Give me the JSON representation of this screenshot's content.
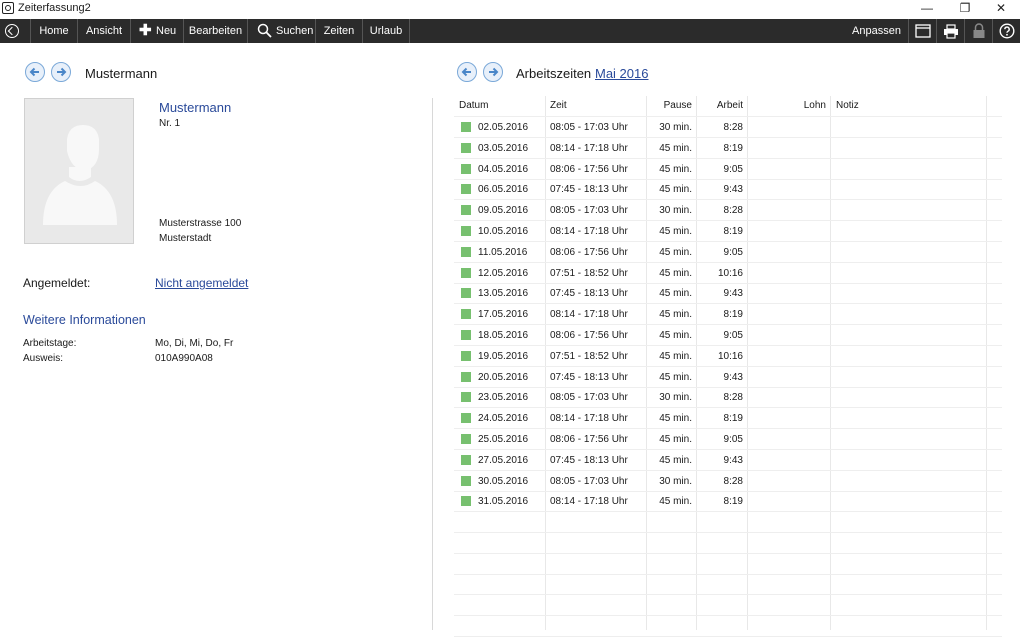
{
  "window": {
    "title": "Zeiterfassung2",
    "controls": [
      "—",
      "❐",
      "✕"
    ]
  },
  "toolbar": {
    "home": "Home",
    "ansicht": "Ansicht",
    "neu": "Neu",
    "bearbeiten": "Bearbeiten",
    "suchen": "Suchen",
    "zeiten": "Zeiten",
    "urlaub": "Urlaub",
    "anpassen": "Anpassen",
    "icons": [
      "back-icon",
      "plus-icon",
      "search-icon",
      "window-icon",
      "print-icon",
      "lock-icon",
      "help-icon"
    ]
  },
  "employee": {
    "header_name": "Mustermann",
    "display_name": "Mustermann",
    "number": "Nr. 1",
    "street": "Musterstrasse 100",
    "city": "Musterstadt",
    "login_label": "Angemeldet:",
    "login_status": "Nicht angemeldet"
  },
  "details": {
    "title": "Weitere Informationen",
    "workdays_label": "Arbeitstage:",
    "workdays_value": "Mo, Di, Mi, Do, Fr",
    "badge_label": "Ausweis:",
    "badge_value": "010A990A08"
  },
  "times": {
    "title": "Arbeitszeiten",
    "month": "Mai 2016",
    "columns": {
      "datum": "Datum",
      "zeit": "Zeit",
      "pause": "Pause",
      "arbeit": "Arbeit",
      "lohn": "Lohn",
      "notiz": "Notiz"
    },
    "status_color": "#77c06f",
    "rows": [
      {
        "datum": "02.05.2016",
        "zeit": "08:05 - 17:03 Uhr",
        "pause": "30 min.",
        "arbeit": "8:28"
      },
      {
        "datum": "03.05.2016",
        "zeit": "08:14 - 17:18 Uhr",
        "pause": "45 min.",
        "arbeit": "8:19"
      },
      {
        "datum": "04.05.2016",
        "zeit": "08:06 - 17:56 Uhr",
        "pause": "45 min.",
        "arbeit": "9:05"
      },
      {
        "datum": "06.05.2016",
        "zeit": "07:45 - 18:13 Uhr",
        "pause": "45 min.",
        "arbeit": "9:43"
      },
      {
        "datum": "09.05.2016",
        "zeit": "08:05 - 17:03 Uhr",
        "pause": "30 min.",
        "arbeit": "8:28"
      },
      {
        "datum": "10.05.2016",
        "zeit": "08:14 - 17:18 Uhr",
        "pause": "45 min.",
        "arbeit": "8:19"
      },
      {
        "datum": "11.05.2016",
        "zeit": "08:06 - 17:56 Uhr",
        "pause": "45 min.",
        "arbeit": "9:05"
      },
      {
        "datum": "12.05.2016",
        "zeit": "07:51 - 18:52 Uhr",
        "pause": "45 min.",
        "arbeit": "10:16"
      },
      {
        "datum": "13.05.2016",
        "zeit": "07:45 - 18:13 Uhr",
        "pause": "45 min.",
        "arbeit": "9:43"
      },
      {
        "datum": "17.05.2016",
        "zeit": "08:14 - 17:18 Uhr",
        "pause": "45 min.",
        "arbeit": "8:19"
      },
      {
        "datum": "18.05.2016",
        "zeit": "08:06 - 17:56 Uhr",
        "pause": "45 min.",
        "arbeit": "9:05"
      },
      {
        "datum": "19.05.2016",
        "zeit": "07:51 - 18:52 Uhr",
        "pause": "45 min.",
        "arbeit": "10:16"
      },
      {
        "datum": "20.05.2016",
        "zeit": "07:45 - 18:13 Uhr",
        "pause": "45 min.",
        "arbeit": "9:43"
      },
      {
        "datum": "23.05.2016",
        "zeit": "08:05 - 17:03 Uhr",
        "pause": "30 min.",
        "arbeit": "8:28"
      },
      {
        "datum": "24.05.2016",
        "zeit": "08:14 - 17:18 Uhr",
        "pause": "45 min.",
        "arbeit": "8:19"
      },
      {
        "datum": "25.05.2016",
        "zeit": "08:06 - 17:56 Uhr",
        "pause": "45 min.",
        "arbeit": "9:05"
      },
      {
        "datum": "27.05.2016",
        "zeit": "07:45 - 18:13 Uhr",
        "pause": "45 min.",
        "arbeit": "9:43"
      },
      {
        "datum": "30.05.2016",
        "zeit": "08:05 - 17:03 Uhr",
        "pause": "30 min.",
        "arbeit": "8:28"
      },
      {
        "datum": "31.05.2016",
        "zeit": "08:14 - 17:18 Uhr",
        "pause": "45 min.",
        "arbeit": "8:19"
      }
    ]
  }
}
